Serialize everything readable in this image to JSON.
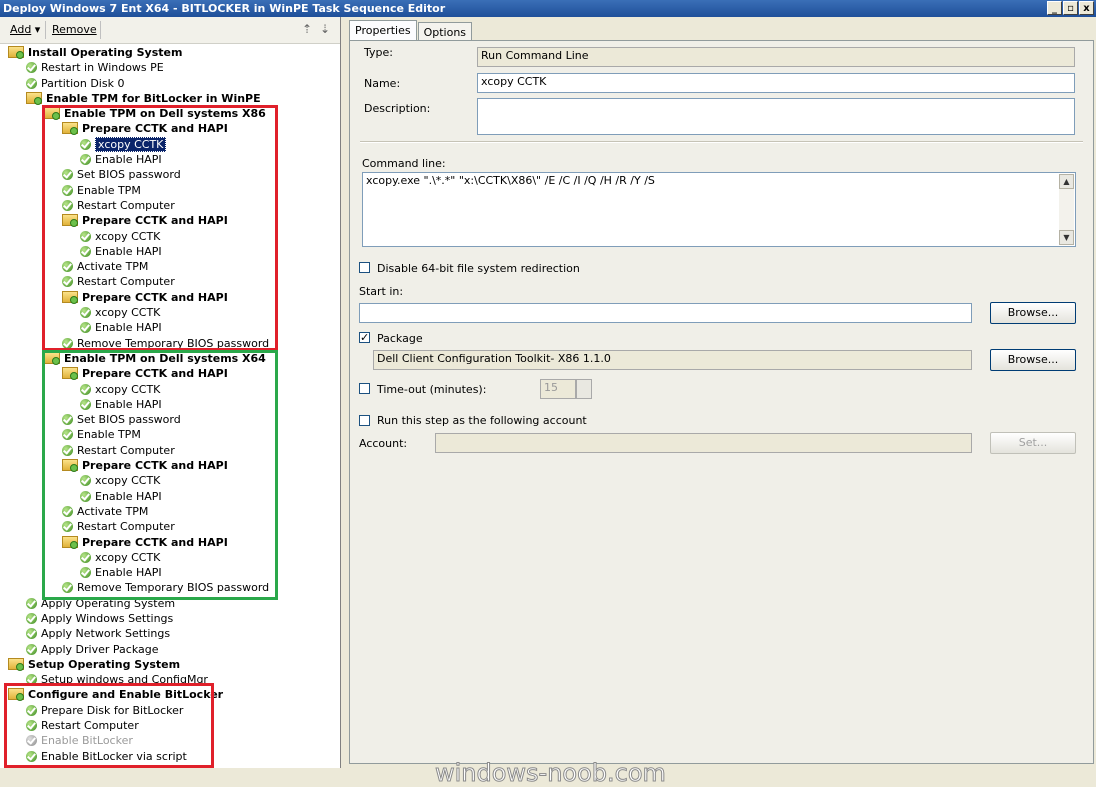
{
  "window": {
    "title": "Deploy Windows 7 Ent X64 - BITLOCKER in WinPE Task Sequence Editor",
    "min": "_",
    "max": "▫",
    "close": "x"
  },
  "toolbar": {
    "add": "Add",
    "remove": "Remove"
  },
  "tree": [
    {
      "label": "Install Operating System",
      "type": "group",
      "depth": 0,
      "bold": true
    },
    {
      "label": "Restart in Windows PE",
      "type": "step",
      "depth": 1
    },
    {
      "label": "Partition Disk 0",
      "type": "step",
      "depth": 1
    },
    {
      "label": "Enable TPM for BitLocker in WinPE",
      "type": "group",
      "depth": 1,
      "bold": true
    },
    {
      "label": "Enable TPM on Dell systems X86",
      "type": "group",
      "depth": 2,
      "bold": true
    },
    {
      "label": "Prepare CCTK and HAPI",
      "type": "group",
      "depth": 3,
      "bold": true
    },
    {
      "label": "xcopy CCTK",
      "type": "step",
      "depth": 4,
      "selected": true
    },
    {
      "label": "Enable HAPI",
      "type": "step",
      "depth": 4
    },
    {
      "label": "Set BIOS password",
      "type": "step",
      "depth": 3
    },
    {
      "label": "Enable TPM",
      "type": "step",
      "depth": 3
    },
    {
      "label": "Restart Computer",
      "type": "step",
      "depth": 3
    },
    {
      "label": "Prepare CCTK and HAPI",
      "type": "group",
      "depth": 3,
      "bold": true
    },
    {
      "label": "xcopy CCTK",
      "type": "step",
      "depth": 4
    },
    {
      "label": "Enable HAPI",
      "type": "step",
      "depth": 4
    },
    {
      "label": "Activate TPM",
      "type": "step",
      "depth": 3
    },
    {
      "label": "Restart Computer",
      "type": "step",
      "depth": 3
    },
    {
      "label": "Prepare CCTK and HAPI",
      "type": "group",
      "depth": 3,
      "bold": true
    },
    {
      "label": "xcopy CCTK",
      "type": "step",
      "depth": 4
    },
    {
      "label": "Enable HAPI",
      "type": "step",
      "depth": 4
    },
    {
      "label": "Remove Temporary BIOS password",
      "type": "step",
      "depth": 3
    },
    {
      "label": "Enable TPM on Dell systems X64",
      "type": "group",
      "depth": 2,
      "bold": true
    },
    {
      "label": "Prepare CCTK and HAPI",
      "type": "group",
      "depth": 3,
      "bold": true
    },
    {
      "label": "xcopy CCTK",
      "type": "step",
      "depth": 4
    },
    {
      "label": "Enable HAPI",
      "type": "step",
      "depth": 4
    },
    {
      "label": "Set BIOS password",
      "type": "step",
      "depth": 3
    },
    {
      "label": "Enable TPM",
      "type": "step",
      "depth": 3
    },
    {
      "label": "Restart Computer",
      "type": "step",
      "depth": 3
    },
    {
      "label": "Prepare CCTK and HAPI",
      "type": "group",
      "depth": 3,
      "bold": true
    },
    {
      "label": "xcopy CCTK",
      "type": "step",
      "depth": 4
    },
    {
      "label": "Enable HAPI",
      "type": "step",
      "depth": 4
    },
    {
      "label": "Activate TPM",
      "type": "step",
      "depth": 3
    },
    {
      "label": "Restart Computer",
      "type": "step",
      "depth": 3
    },
    {
      "label": "Prepare CCTK and HAPI",
      "type": "group",
      "depth": 3,
      "bold": true
    },
    {
      "label": "xcopy CCTK",
      "type": "step",
      "depth": 4
    },
    {
      "label": "Enable HAPI",
      "type": "step",
      "depth": 4
    },
    {
      "label": "Remove Temporary BIOS password",
      "type": "step",
      "depth": 3
    },
    {
      "label": "Apply Operating System",
      "type": "step",
      "depth": 1
    },
    {
      "label": "Apply Windows Settings",
      "type": "step",
      "depth": 1
    },
    {
      "label": "Apply Network Settings",
      "type": "step",
      "depth": 1
    },
    {
      "label": "Apply Driver Package",
      "type": "step",
      "depth": 1
    },
    {
      "label": "Setup Operating System",
      "type": "group",
      "depth": 0,
      "bold": true
    },
    {
      "label": "Setup windows and ConfigMgr",
      "type": "step",
      "depth": 1
    },
    {
      "label": "Configure and Enable BitLocker",
      "type": "group",
      "depth": 0,
      "bold": true
    },
    {
      "label": "Prepare Disk for BitLocker",
      "type": "step",
      "depth": 1
    },
    {
      "label": "Restart Computer",
      "type": "step",
      "depth": 1
    },
    {
      "label": "Enable BitLocker",
      "type": "step",
      "depth": 1,
      "disabled": true
    },
    {
      "label": "Enable BitLocker via script",
      "type": "step",
      "depth": 1
    }
  ],
  "tabs": [
    "Properties",
    "Options"
  ],
  "props": {
    "type_label": "Type:",
    "type_value": "Run Command Line",
    "name_label": "Name:",
    "name_value": "xcopy CCTK",
    "desc_label": "Description:",
    "desc_value": "",
    "cmd_label": "Command line:",
    "cmd_value": "xcopy.exe \".\\*.*\" \"x:\\CCTK\\X86\\\" /E /C /I /Q /H /R /Y /S",
    "disable64_label": "Disable 64-bit file system redirection",
    "startin_label": "Start in:",
    "startin_value": "",
    "browse1": "Browse...",
    "package_label": "Package",
    "package_value": "Dell Client Configuration Toolkit- X86 1.1.0",
    "browse2": "Browse...",
    "timeout_label": "Time-out (minutes):",
    "timeout_value": "15",
    "runas_label": "Run this step as the following account",
    "account_label": "Account:",
    "account_value": "",
    "set_label": "Set..."
  },
  "watermark": "windows-noob.com",
  "colors": {
    "red_box": "#e0202a",
    "green_box": "#2aa84a",
    "selection": "#0a246a"
  }
}
